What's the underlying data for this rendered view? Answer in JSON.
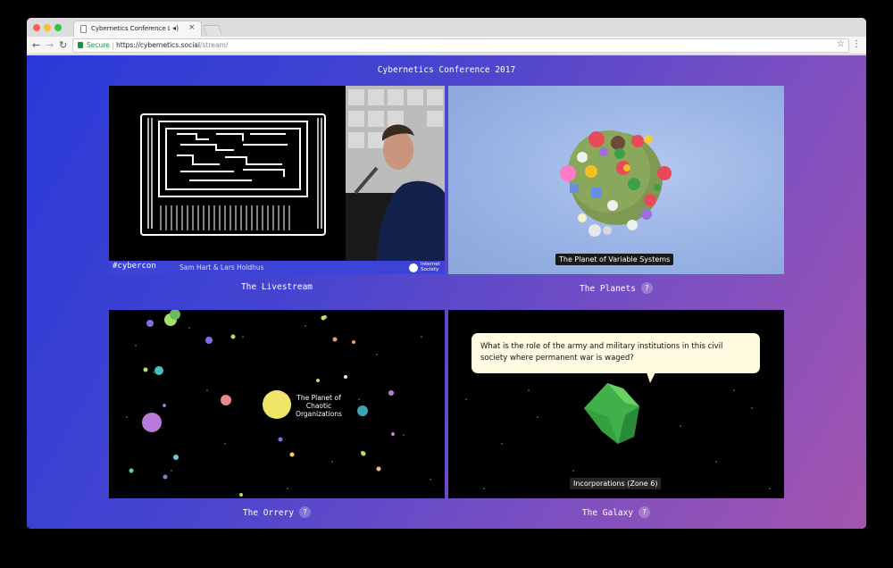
{
  "browser": {
    "tab_title": "Cybernetics Conference Li",
    "secure_label": "Secure",
    "url_host": "https://cybernetics.social",
    "url_path": "/stream/"
  },
  "page": {
    "title": "Cybernetics Conference 2017"
  },
  "panels": {
    "livestream": {
      "label": "The Livestream",
      "hashtag": "#cybercon",
      "speakers": "Sam Hart & Lars Holdhus",
      "logo_text_line1": "Internet",
      "logo_text_line2": "Society"
    },
    "planets": {
      "label": "The Planets",
      "help": "?",
      "caption": "The Planet of Variable Systems"
    },
    "orrery": {
      "label": "The Orrery",
      "help": "?",
      "planet_label": "The Planet of Chaotic Organizations"
    },
    "galaxy": {
      "label": "The Galaxy",
      "help": "?",
      "question": "What is the role of the army and military institutions in this civil society where permanent war is waged?",
      "caption": "Incorporations (Zone 6)"
    }
  },
  "colors": {
    "gradient_start": "#2a3ad8",
    "gradient_end": "#a455ae",
    "live_bar": "#3d43d6",
    "speech_bubble": "#fffbe0"
  }
}
